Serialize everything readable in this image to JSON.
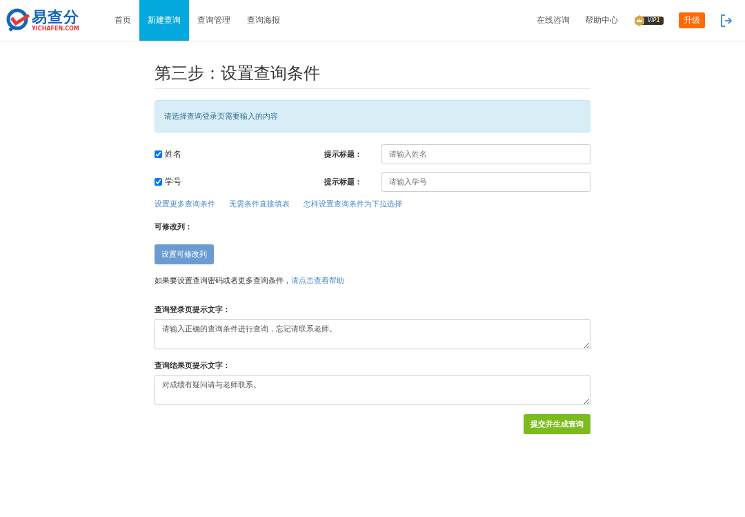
{
  "logo": {
    "name": "易查分",
    "domain": "YICHAFEN.COM"
  },
  "nav": [
    {
      "label": "首页",
      "selected": false
    },
    {
      "label": "新建查询",
      "selected": true
    },
    {
      "label": "查询管理",
      "selected": false
    },
    {
      "label": "查询海报",
      "selected": false
    }
  ],
  "header_links": [
    "在线咨询",
    "帮助中心"
  ],
  "vip_badge": {
    "text": "VIP",
    "level_text": "1"
  },
  "upgrade_button": "升级",
  "heading": "第三步：设置查询条件",
  "notice": "请选择查询登录页需要输入的内容",
  "conditions": [
    {
      "name": "姓名",
      "checked": true,
      "hint_label": "提示标题：",
      "placeholder": "请输入姓名"
    },
    {
      "name": "学号",
      "checked": true,
      "hint_label": "提示标题：",
      "placeholder": "请输入学号"
    }
  ],
  "option_links": [
    "设置更多查询条件",
    "无需条件直接填表",
    "怎样设置查询条件为下拉选择"
  ],
  "editable_columns": {
    "label": "可修改列：",
    "button": "设置可修改列"
  },
  "help": {
    "text": "如果要设置查询密码或者更多查询条件，",
    "link": "请点击查看帮助"
  },
  "messages": [
    {
      "label": "查询登录页提示文字：",
      "value": "请输入正确的查询条件进行查询，忘记请联系老师。"
    },
    {
      "label": "查询结果页提示文字：",
      "value": "对成绩有疑问请与老师联系。"
    }
  ],
  "submit_button": "提交并生成查询"
}
